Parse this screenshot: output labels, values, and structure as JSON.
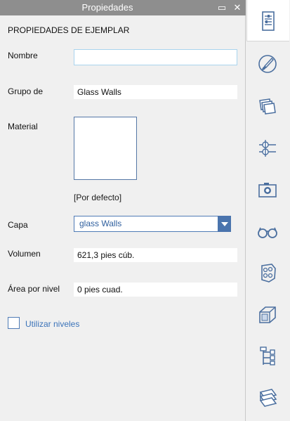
{
  "window": {
    "title": "Propiedades",
    "restore_glyph": "▭",
    "close_glyph": "✕"
  },
  "section_title": "PROPIEDADES DE EJEMPLAR",
  "fields": {
    "nombre": {
      "label": "Nombre",
      "value": ""
    },
    "grupo": {
      "label": "Grupo de",
      "value": "Glass Walls"
    },
    "material": {
      "label": "Material",
      "default_text": "[Por defecto]"
    },
    "capa": {
      "label": "Capa",
      "value": "glass Walls"
    },
    "volumen": {
      "label": "Volumen",
      "value": "621,3 pies cúb."
    },
    "area": {
      "label": "Área por nivel",
      "value": "0 pies cuad."
    }
  },
  "checkbox": {
    "label": "Utilizar niveles",
    "checked": false
  },
  "toolbar": {
    "items": [
      {
        "icon": "properties-icon",
        "active": true
      },
      {
        "icon": "paint-brush-icon",
        "active": false
      },
      {
        "icon": "layers-icon",
        "active": false
      },
      {
        "icon": "sliders-icon",
        "active": false
      },
      {
        "icon": "camera-icon",
        "active": false
      },
      {
        "icon": "glasses-icon",
        "active": false
      },
      {
        "icon": "film-reel-icon",
        "active": false
      },
      {
        "icon": "solid-box-icon",
        "active": false
      },
      {
        "icon": "hierarchy-icon",
        "active": false
      },
      {
        "icon": "stack-icon",
        "active": false
      }
    ]
  },
  "colors": {
    "titlebar": "#8e8e8e",
    "accent": "#4a74ad",
    "link_text": "#3b73b9",
    "icon": "#4b6f9f"
  }
}
